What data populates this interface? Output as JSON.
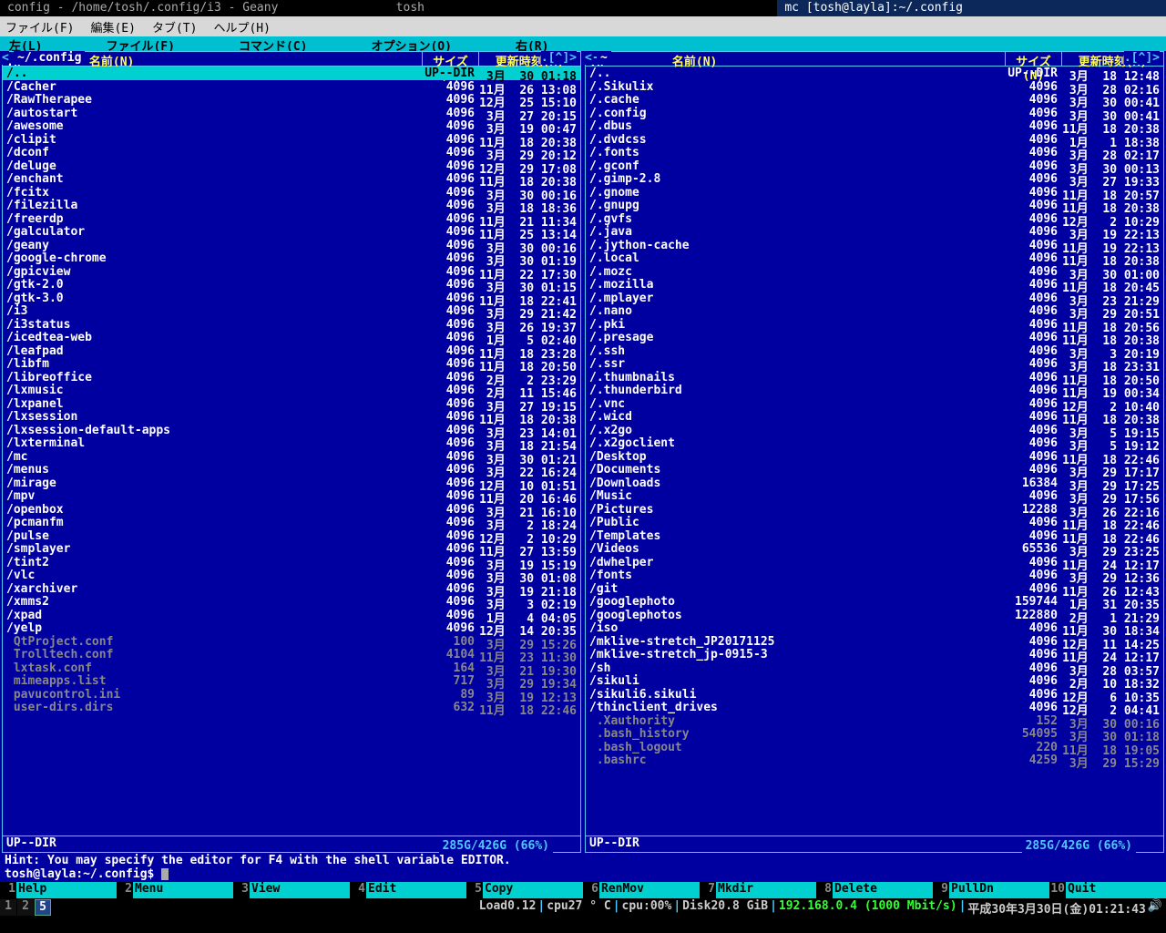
{
  "title_tabs": [
    {
      "label": "config - /home/tosh/.config/i3 - Geany",
      "active": false
    },
    {
      "label": "tosh",
      "active": false
    },
    {
      "label": "mc [tosh@layla]:~/.config",
      "active": true
    }
  ],
  "menubar": [
    "ファイル(F)",
    "編集(E)",
    "タブ(T)",
    "ヘルプ(H)"
  ],
  "mc_menu": [
    "左(L)",
    "ファイル(F)",
    "コマンド(C)",
    "オプション(O)",
    "右(R)"
  ],
  "cols": {
    "n": ".n",
    "name": "名前(N)",
    "size": "サイズ(N)",
    "mtime": "更新時刻(M)"
  },
  "left": {
    "title": "~/.config",
    "footer": "UP--DIR",
    "disk": "285G/426G (66%)",
    "rows": [
      {
        "n": "/..",
        "s": "UP--DIR",
        "t": " 3月  30 01:18",
        "sel": true,
        "dir": true
      },
      {
        "n": "/Cacher",
        "s": "4096",
        "t": "11月  26 13:08",
        "dir": true
      },
      {
        "n": "/RawTherapee",
        "s": "4096",
        "t": "12月  25 15:10",
        "dir": true
      },
      {
        "n": "/autostart",
        "s": "4096",
        "t": " 3月  27 20:15",
        "dir": true
      },
      {
        "n": "/awesome",
        "s": "4096",
        "t": " 3月  19 00:47",
        "dir": true
      },
      {
        "n": "/clipit",
        "s": "4096",
        "t": "11月  18 20:38",
        "dir": true
      },
      {
        "n": "/dconf",
        "s": "4096",
        "t": " 3月  29 20:12",
        "dir": true
      },
      {
        "n": "/deluge",
        "s": "4096",
        "t": "12月  29 17:08",
        "dir": true
      },
      {
        "n": "/enchant",
        "s": "4096",
        "t": "11月  18 20:38",
        "dir": true
      },
      {
        "n": "/fcitx",
        "s": "4096",
        "t": " 3月  30 00:16",
        "dir": true
      },
      {
        "n": "/filezilla",
        "s": "4096",
        "t": " 3月  18 18:36",
        "dir": true
      },
      {
        "n": "/freerdp",
        "s": "4096",
        "t": "11月  21 11:34",
        "dir": true
      },
      {
        "n": "/galculator",
        "s": "4096",
        "t": "11月  25 13:14",
        "dir": true
      },
      {
        "n": "/geany",
        "s": "4096",
        "t": " 3月  30 00:16",
        "dir": true
      },
      {
        "n": "/google-chrome",
        "s": "4096",
        "t": " 3月  30 01:19",
        "dir": true
      },
      {
        "n": "/gpicview",
        "s": "4096",
        "t": "11月  22 17:30",
        "dir": true
      },
      {
        "n": "/gtk-2.0",
        "s": "4096",
        "t": " 3月  30 01:15",
        "dir": true
      },
      {
        "n": "/gtk-3.0",
        "s": "4096",
        "t": "11月  18 22:41",
        "dir": true
      },
      {
        "n": "/i3",
        "s": "4096",
        "t": " 3月  29 21:42",
        "dir": true
      },
      {
        "n": "/i3status",
        "s": "4096",
        "t": " 3月  26 19:37",
        "dir": true
      },
      {
        "n": "/icedtea-web",
        "s": "4096",
        "t": " 1月   5 02:40",
        "dir": true
      },
      {
        "n": "/leafpad",
        "s": "4096",
        "t": "11月  18 23:28",
        "dir": true
      },
      {
        "n": "/libfm",
        "s": "4096",
        "t": "11月  18 20:50",
        "dir": true
      },
      {
        "n": "/libreoffice",
        "s": "4096",
        "t": " 2月   2 23:29",
        "dir": true
      },
      {
        "n": "/lxmusic",
        "s": "4096",
        "t": " 2月  11 15:46",
        "dir": true
      },
      {
        "n": "/lxpanel",
        "s": "4096",
        "t": " 3月  27 19:15",
        "dir": true
      },
      {
        "n": "/lxsession",
        "s": "4096",
        "t": "11月  18 20:38",
        "dir": true
      },
      {
        "n": "/lxsession-default-apps",
        "s": "4096",
        "t": " 3月  23 14:01",
        "dir": true
      },
      {
        "n": "/lxterminal",
        "s": "4096",
        "t": " 3月  18 21:54",
        "dir": true
      },
      {
        "n": "/mc",
        "s": "4096",
        "t": " 3月  30 01:21",
        "dir": true
      },
      {
        "n": "/menus",
        "s": "4096",
        "t": " 3月  22 16:24",
        "dir": true
      },
      {
        "n": "/mirage",
        "s": "4096",
        "t": "12月  10 01:51",
        "dir": true
      },
      {
        "n": "/mpv",
        "s": "4096",
        "t": "11月  20 16:46",
        "dir": true
      },
      {
        "n": "/openbox",
        "s": "4096",
        "t": " 3月  21 16:10",
        "dir": true
      },
      {
        "n": "/pcmanfm",
        "s": "4096",
        "t": " 3月   2 18:24",
        "dir": true
      },
      {
        "n": "/pulse",
        "s": "4096",
        "t": "12月   2 10:29",
        "dir": true
      },
      {
        "n": "/smplayer",
        "s": "4096",
        "t": "11月  27 13:59",
        "dir": true
      },
      {
        "n": "/tint2",
        "s": "4096",
        "t": " 3月  19 15:19",
        "dir": true
      },
      {
        "n": "/vlc",
        "s": "4096",
        "t": " 3月  30 01:08",
        "dir": true
      },
      {
        "n": "/xarchiver",
        "s": "4096",
        "t": " 3月  19 21:18",
        "dir": true
      },
      {
        "n": "/xmms2",
        "s": "4096",
        "t": " 3月   3 02:19",
        "dir": true
      },
      {
        "n": "/xpad",
        "s": "4096",
        "t": " 1月   4 04:05",
        "dir": true
      },
      {
        "n": "/yelp",
        "s": "4096",
        "t": "12月  14 20:35",
        "dir": true
      },
      {
        "n": " QtProject.conf",
        "s": "100",
        "t": " 3月  29 15:26",
        "dir": false
      },
      {
        "n": " Trolltech.conf",
        "s": "4104",
        "t": "11月  23 11:30",
        "dir": false
      },
      {
        "n": " lxtask.conf",
        "s": "164",
        "t": " 3月  21 19:30",
        "dir": false
      },
      {
        "n": " mimeapps.list",
        "s": "717",
        "t": " 3月  29 19:34",
        "dir": false
      },
      {
        "n": " pavucontrol.ini",
        "s": "89",
        "t": " 3月  19 12:13",
        "dir": false
      },
      {
        "n": " user-dirs.dirs",
        "s": "632",
        "t": "11月  18 22:46",
        "dir": false
      }
    ]
  },
  "right": {
    "title": "~",
    "footer": "UP--DIR",
    "disk": "285G/426G (66%)",
    "rows": [
      {
        "n": "/..",
        "s": "UP--DIR",
        "t": " 3月  18 12:48",
        "dir": true
      },
      {
        "n": "/.Sikulix",
        "s": "4096",
        "t": " 3月  28 02:16",
        "dir": true
      },
      {
        "n": "/.cache",
        "s": "4096",
        "t": " 3月  30 00:41",
        "dir": true
      },
      {
        "n": "/.config",
        "s": "4096",
        "t": " 3月  30 00:41",
        "dir": true
      },
      {
        "n": "/.dbus",
        "s": "4096",
        "t": "11月  18 20:38",
        "dir": true
      },
      {
        "n": "/.dvdcss",
        "s": "4096",
        "t": " 1月   1 18:38",
        "dir": true
      },
      {
        "n": "/.fonts",
        "s": "4096",
        "t": " 3月  28 02:17",
        "dir": true
      },
      {
        "n": "/.gconf",
        "s": "4096",
        "t": " 3月  30 00:13",
        "dir": true
      },
      {
        "n": "/.gimp-2.8",
        "s": "4096",
        "t": " 3月  27 19:33",
        "dir": true
      },
      {
        "n": "/.gnome",
        "s": "4096",
        "t": "11月  18 20:57",
        "dir": true
      },
      {
        "n": "/.gnupg",
        "s": "4096",
        "t": "11月  18 20:38",
        "dir": true
      },
      {
        "n": "/.gvfs",
        "s": "4096",
        "t": "12月   2 10:29",
        "dir": true
      },
      {
        "n": "/.java",
        "s": "4096",
        "t": " 3月  19 22:13",
        "dir": true
      },
      {
        "n": "/.jython-cache",
        "s": "4096",
        "t": "11月  19 22:13",
        "dir": true
      },
      {
        "n": "/.local",
        "s": "4096",
        "t": "11月  18 20:38",
        "dir": true
      },
      {
        "n": "/.mozc",
        "s": "4096",
        "t": " 3月  30 01:00",
        "dir": true
      },
      {
        "n": "/.mozilla",
        "s": "4096",
        "t": "11月  18 20:45",
        "dir": true
      },
      {
        "n": "/.mplayer",
        "s": "4096",
        "t": " 3月  23 21:29",
        "dir": true
      },
      {
        "n": "/.nano",
        "s": "4096",
        "t": " 3月  29 20:51",
        "dir": true
      },
      {
        "n": "/.pki",
        "s": "4096",
        "t": "11月  18 20:56",
        "dir": true
      },
      {
        "n": "/.presage",
        "s": "4096",
        "t": "11月  18 20:38",
        "dir": true
      },
      {
        "n": "/.ssh",
        "s": "4096",
        "t": " 3月   3 20:19",
        "dir": true
      },
      {
        "n": "/.ssr",
        "s": "4096",
        "t": " 3月  18 23:31",
        "dir": true
      },
      {
        "n": "/.thumbnails",
        "s": "4096",
        "t": "11月  18 20:50",
        "dir": true
      },
      {
        "n": "/.thunderbird",
        "s": "4096",
        "t": "11月  19 00:34",
        "dir": true
      },
      {
        "n": "/.vnc",
        "s": "4096",
        "t": "12月   2 10:40",
        "dir": true
      },
      {
        "n": "/.wicd",
        "s": "4096",
        "t": "11月  18 20:38",
        "dir": true
      },
      {
        "n": "/.x2go",
        "s": "4096",
        "t": " 3月   5 19:15",
        "dir": true
      },
      {
        "n": "/.x2goclient",
        "s": "4096",
        "t": " 3月   5 19:12",
        "dir": true
      },
      {
        "n": "/Desktop",
        "s": "4096",
        "t": "11月  18 22:46",
        "dir": true
      },
      {
        "n": "/Documents",
        "s": "4096",
        "t": " 3月  29 17:17",
        "dir": true
      },
      {
        "n": "/Downloads",
        "s": "16384",
        "t": " 3月  29 17:25",
        "dir": true
      },
      {
        "n": "/Music",
        "s": "4096",
        "t": " 3月  29 17:56",
        "dir": true
      },
      {
        "n": "/Pictures",
        "s": "12288",
        "t": " 3月  26 22:16",
        "dir": true
      },
      {
        "n": "/Public",
        "s": "4096",
        "t": "11月  18 22:46",
        "dir": true
      },
      {
        "n": "/Templates",
        "s": "4096",
        "t": "11月  18 22:46",
        "dir": true
      },
      {
        "n": "/Videos",
        "s": "65536",
        "t": " 3月  29 23:25",
        "dir": true
      },
      {
        "n": "/dwhelper",
        "s": "4096",
        "t": "11月  24 12:17",
        "dir": true
      },
      {
        "n": "/fonts",
        "s": "4096",
        "t": " 3月  29 12:36",
        "dir": true
      },
      {
        "n": "/git",
        "s": "4096",
        "t": "11月  26 12:43",
        "dir": true
      },
      {
        "n": "/googlephoto",
        "s": "159744",
        "t": " 1月  31 20:35",
        "dir": true
      },
      {
        "n": "/googlephotos",
        "s": "122880",
        "t": " 2月   1 21:29",
        "dir": true
      },
      {
        "n": "/iso",
        "s": "4096",
        "t": "11月  30 18:34",
        "dir": true
      },
      {
        "n": "/mklive-stretch_JP20171125",
        "s": "4096",
        "t": "12月  11 14:25",
        "dir": true
      },
      {
        "n": "/mklive-stretch_jp-0915-3",
        "s": "4096",
        "t": "11月  24 12:17",
        "dir": true
      },
      {
        "n": "/sh",
        "s": "4096",
        "t": " 3月  28 03:57",
        "dir": true
      },
      {
        "n": "/sikuli",
        "s": "4096",
        "t": " 2月  10 18:32",
        "dir": true
      },
      {
        "n": "/sikuli6.sikuli",
        "s": "4096",
        "t": "12月   6 10:35",
        "dir": true
      },
      {
        "n": "/thinclient_drives",
        "s": "4096",
        "t": "12月   2 04:41",
        "dir": true
      },
      {
        "n": " .Xauthority",
        "s": "152",
        "t": " 3月  30 00:16",
        "dir": false
      },
      {
        "n": " .bash_history",
        "s": "54095",
        "t": " 3月  30 01:18",
        "dir": false
      },
      {
        "n": " .bash_logout",
        "s": "220",
        "t": "11月  18 19:05",
        "dir": false
      },
      {
        "n": " .bashrc",
        "s": "4259",
        "t": " 3月  29 15:29",
        "dir": false
      }
    ]
  },
  "hint": "Hint: You may specify the editor for F4 with the shell variable EDITOR.",
  "prompt": "tosh@layla:~/.config$ ",
  "fkeys": [
    {
      "n": "1",
      "l": "Help"
    },
    {
      "n": "2",
      "l": "Menu"
    },
    {
      "n": "3",
      "l": "View"
    },
    {
      "n": "4",
      "l": "Edit"
    },
    {
      "n": "5",
      "l": "Copy"
    },
    {
      "n": "6",
      "l": "RenMov"
    },
    {
      "n": "7",
      "l": "Mkdir"
    },
    {
      "n": "8",
      "l": "Delete"
    },
    {
      "n": "9",
      "l": "PullDn"
    },
    {
      "n": "10",
      "l": "Quit"
    }
  ],
  "workspaces": [
    "1",
    "2",
    "5"
  ],
  "active_ws": "5",
  "status": {
    "load": "Load0.12",
    "cpu_temp": "cpu27 ° C",
    "cpu": "cpu:00%",
    "disk": "Disk20.8 GiB",
    "net": "192.168.0.4 (1000 Mbit/s)",
    "date": "平成30年3月30日(金)01:21:43"
  }
}
